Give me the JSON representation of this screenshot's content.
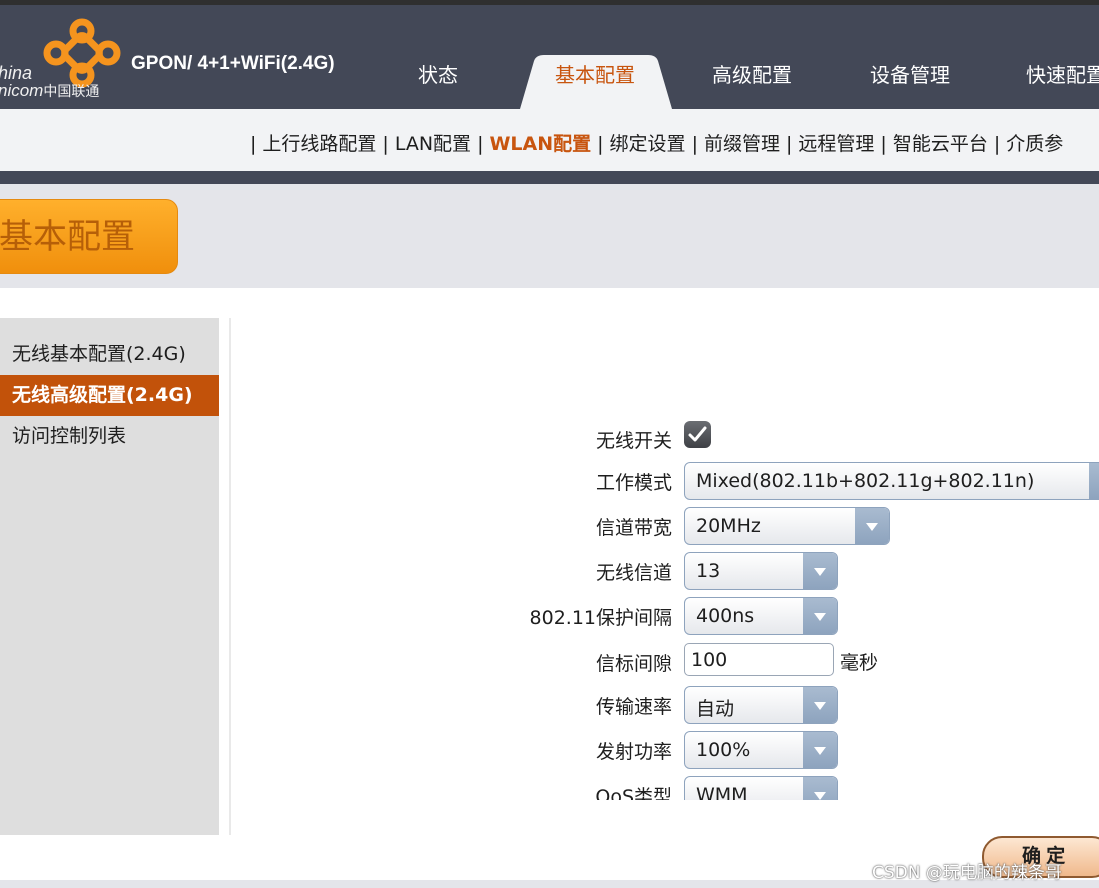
{
  "header": {
    "logo_line1": "hina",
    "logo_line2": "nicom",
    "logo_line2_cn": "中国联通",
    "model": "GPON/ 4+1+WiFi(2.4G)",
    "tabs": [
      {
        "label": "状态"
      },
      {
        "label": "基本配置",
        "active": true
      },
      {
        "label": "高级配置"
      },
      {
        "label": "设备管理"
      },
      {
        "label": "快速配置"
      }
    ],
    "accent_color": "#c8550f"
  },
  "subnav": {
    "items": [
      {
        "label": "上行线路配置"
      },
      {
        "label": "LAN配置"
      },
      {
        "label": "WLAN配置",
        "active": true
      },
      {
        "label": "绑定设置"
      },
      {
        "label": "前缀管理"
      },
      {
        "label": "远程管理"
      },
      {
        "label": "智能云平台"
      },
      {
        "label": "介质参"
      }
    ],
    "separator": "|"
  },
  "page_title": "基本配置",
  "sidebar": {
    "items": [
      {
        "label": "无线基本配置(2.4G)"
      },
      {
        "label": "无线高级配置(2.4G)",
        "active": true
      },
      {
        "label": "访问控制列表"
      }
    ]
  },
  "form": {
    "wireless_switch": {
      "label": "无线开关",
      "checked": true
    },
    "work_mode": {
      "label": "工作模式",
      "value": "Mixed(802.11b+802.11g+802.11n)"
    },
    "channel_bandwidth": {
      "label": "信道带宽",
      "value": "20MHz"
    },
    "wireless_channel": {
      "label": "无线信道",
      "value": "13"
    },
    "guard_interval": {
      "label": "802.11保护间隔",
      "value": "400ns"
    },
    "beacon_interval": {
      "label": "信标间隙",
      "value": "100",
      "unit": "毫秒"
    },
    "tx_rate": {
      "label": "传输速率",
      "value": "自动"
    },
    "tx_power": {
      "label": "发射功率",
      "value": "100%"
    },
    "qos_type": {
      "label": "QoS类型",
      "value": "WMM"
    }
  },
  "confirm_label": "确 定",
  "watermark": "CSDN @玩电脑的辣条哥"
}
